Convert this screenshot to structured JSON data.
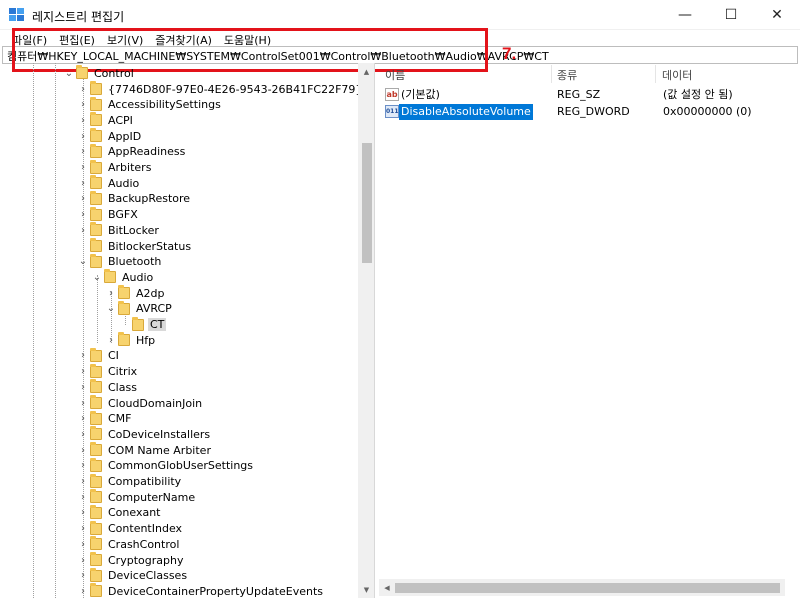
{
  "window": {
    "title": "레지스트리 편집기",
    "minimize": "—",
    "maximize": "☐",
    "close": "✕"
  },
  "menu": [
    "파일(F)",
    "편집(E)",
    "보기(V)",
    "즐겨찾기(A)",
    "도움말(H)"
  ],
  "address": "컴퓨터₩HKEY_LOCAL_MACHINE₩SYSTEM₩ControlSet001₩Control₩Bluetooth₩Audio₩AVRCP₩CT",
  "annotation": {
    "step": "7.",
    "color": "#e3131a"
  },
  "tree": {
    "root_item": "Control",
    "items": [
      "{7746D80F-97E0-4E26-9543-26B41FC22F79}",
      "AccessibilitySettings",
      "ACPI",
      "AppID",
      "AppReadiness",
      "Arbiters",
      "Audio",
      "BackupRestore",
      "BGFX",
      "BitLocker",
      "BitlockerStatus",
      "Bluetooth",
      "Audio",
      "A2dp",
      "AVRCP",
      "CT",
      "Hfp",
      "CI",
      "Citrix",
      "Class",
      "CloudDomainJoin",
      "CMF",
      "CoDeviceInstallers",
      "COM Name Arbiter",
      "CommonGlobUserSettings",
      "Compatibility",
      "ComputerName",
      "Conexant",
      "ContentIndex",
      "CrashControl",
      "Cryptography",
      "DeviceClasses",
      "DeviceContainerPropertyUpdateEvents"
    ]
  },
  "list": {
    "headers": {
      "name": "이름",
      "type": "종류",
      "data": "데이터"
    },
    "rows": [
      {
        "icon": "ab",
        "name": "(기본값)",
        "type": "REG_SZ",
        "data": "(값 설정 안 됨)"
      },
      {
        "icon": "011",
        "name": "DisableAbsoluteVolume",
        "type": "REG_DWORD",
        "data": "0x00000000 (0)"
      }
    ]
  },
  "colors": {
    "selection": "#0078d7",
    "folder": "#f7d36e",
    "annotation": "#e3131a"
  }
}
